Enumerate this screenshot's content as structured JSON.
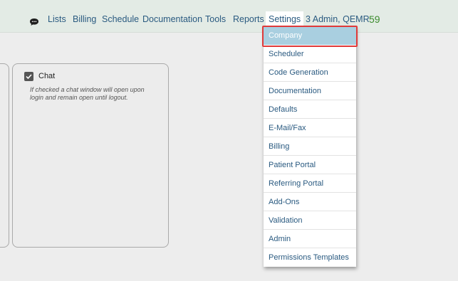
{
  "nav": {
    "items": [
      "Lists",
      "Billing",
      "Schedule",
      "Documentation",
      "Tools",
      "Reports",
      "Settings"
    ],
    "user": "3 Admin, QEMR",
    "count": "59",
    "active": "Settings"
  },
  "chat_card": {
    "title": "Chat",
    "checked": true,
    "description": "If checked a chat window will open upon login and remain open until logout."
  },
  "settings_menu": {
    "items": [
      "Company",
      "Scheduler",
      "Code Generation",
      "Documentation",
      "Defaults",
      "E-Mail/Fax",
      "Billing",
      "Patient Portal",
      "Referring Portal",
      "Add-Ons",
      "Validation",
      "Admin",
      "Permissions Templates"
    ],
    "highlighted": "Company"
  },
  "colors": {
    "topbar": "#e3ebe5",
    "nav_text": "#2a5a80",
    "count": "#3d8c2f",
    "highlight": "#a9cfe0",
    "focus_ring": "#e03a3a"
  }
}
